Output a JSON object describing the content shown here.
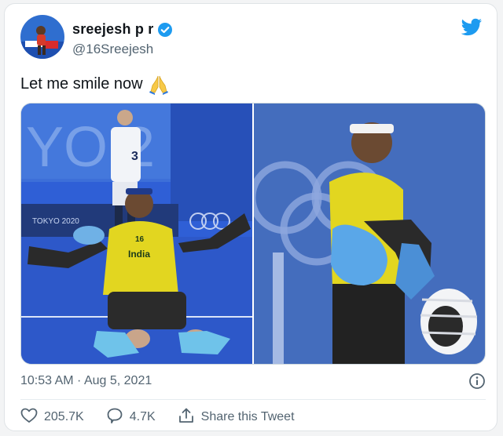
{
  "author": {
    "display_name": "sreejesh p r",
    "handle": "@16Sreejesh",
    "verified": true
  },
  "tweet": {
    "text": "Let me smile now",
    "emoji": "folded-hands-emoji",
    "timestamp": "10:53 AM · Aug 5, 2021"
  },
  "photos": {
    "left_sign": "TOKYO 2020",
    "left_number": "3",
    "jersey_number": "16",
    "jersey_text": "India"
  },
  "actions": {
    "likes": "205.7K",
    "replies": "4.7K",
    "share_label": "Share this Tweet"
  },
  "colors": {
    "twitter_blue": "#1d9bf0",
    "text_secondary": "#536471",
    "turf_blue": "#2f5fd6",
    "jersey_yellow": "#e2d620"
  }
}
